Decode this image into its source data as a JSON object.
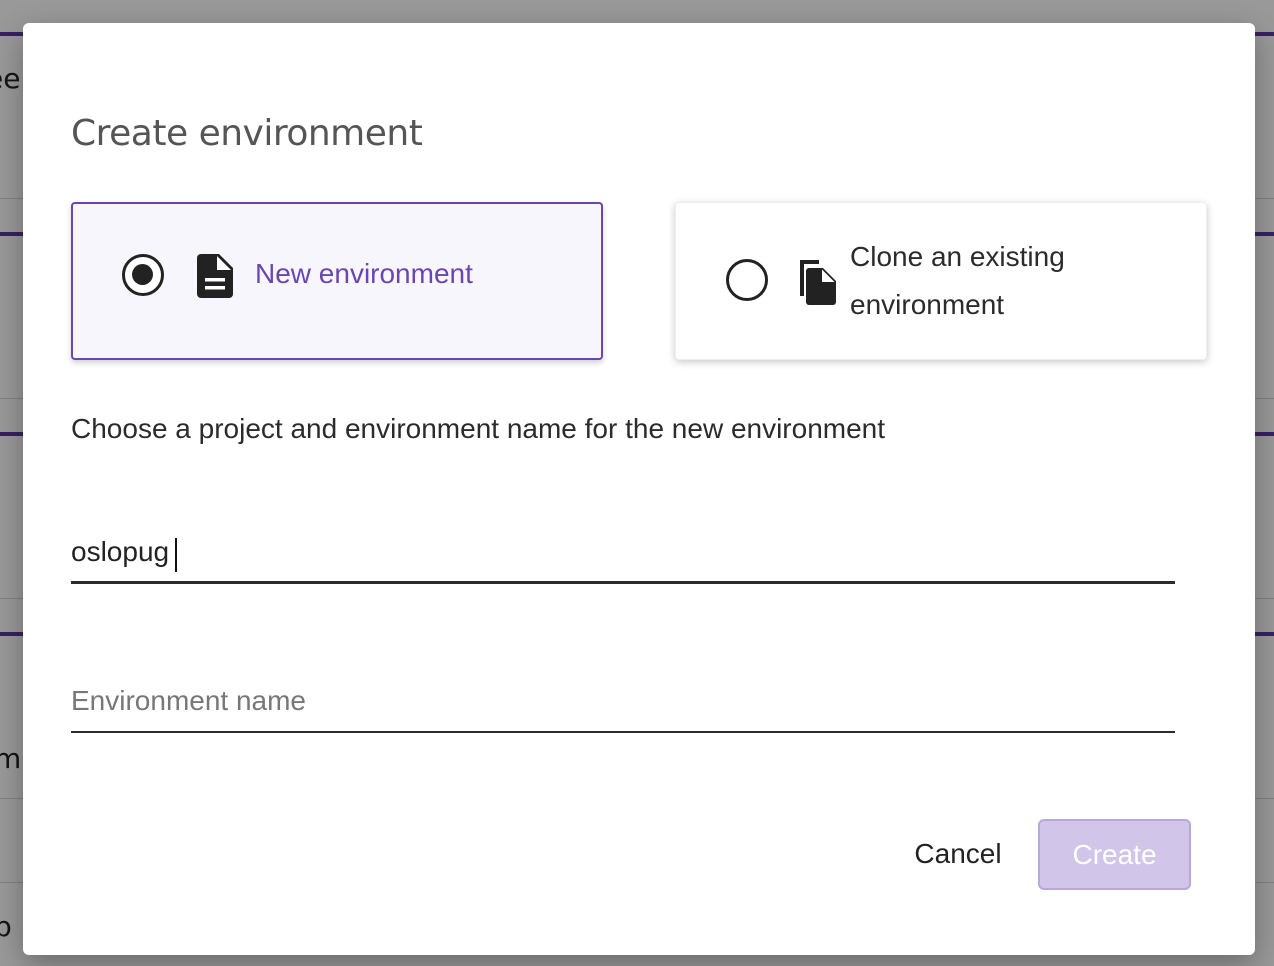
{
  "background": {
    "fragments": [
      "ee",
      "m",
      "p"
    ]
  },
  "dialog": {
    "title": "Create environment",
    "options": [
      {
        "label": "New environment",
        "icon": "document-icon",
        "selected": true
      },
      {
        "label": "Clone an existing environment",
        "icon": "copy-documents-icon",
        "selected": false
      }
    ],
    "instructions": "Choose a project and environment name for the new environment",
    "project_field": {
      "value": "oslopug"
    },
    "environment_field": {
      "value": "",
      "placeholder": "Environment name"
    },
    "cancel_label": "Cancel",
    "create_label": "Create"
  },
  "colors": {
    "accent": "#6b46b0",
    "create_disabled": "#d1c5ea"
  }
}
